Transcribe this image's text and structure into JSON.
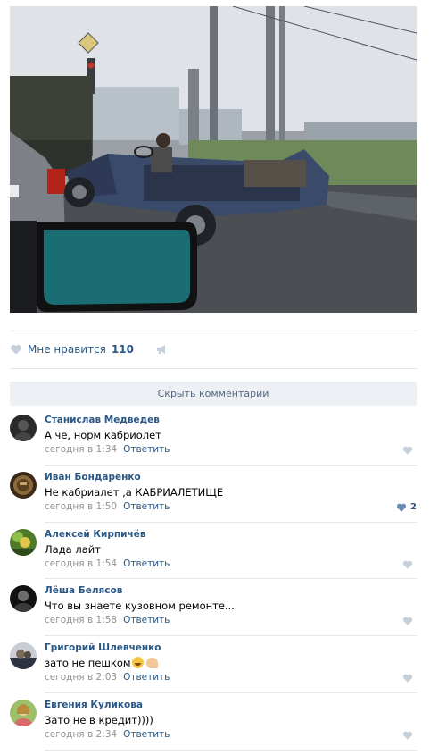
{
  "post": {
    "likes_label": "Мне нравится",
    "likes_count": "110",
    "hide_comments_label": "Скрыть комментарии"
  },
  "comments": [
    {
      "author": "Станислав Медведев",
      "text": "А че, норм кабриолет",
      "time": "сегодня в 1:34",
      "reply": "Ответить",
      "likes": ""
    },
    {
      "author": "Иван Бондаренко",
      "text": "Не кабриалет ,а КАБРИАЛЕТИЩЕ",
      "time": "сегодня в 1:50",
      "reply": "Ответить",
      "likes": "2"
    },
    {
      "author": "Алексей Кирпичёв",
      "text": "Лада лайт",
      "time": "сегодня в 1:54",
      "reply": "Ответить",
      "likes": ""
    },
    {
      "author": "Лёша Белясов",
      "text": "Что вы знаете кузовном ремонте...",
      "time": "сегодня в 1:58",
      "reply": "Ответить",
      "likes": ""
    },
    {
      "author": "Григорий Шлевченко",
      "text": "зато не пешком",
      "time": "сегодня в 2:03",
      "reply": "Ответить",
      "likes": ""
    },
    {
      "author": "Евгения Куликова",
      "text": "Зато не в кредит))))",
      "time": "сегодня в 2:34",
      "reply": "Ответить",
      "likes": ""
    }
  ],
  "colors": {
    "link": "#2a5885",
    "muted": "#939393",
    "icon": "#c5d0db",
    "icon_active": "#6b8db5"
  },
  "icons": {
    "like": "heart-icon",
    "share": "megaphone-icon",
    "emoji": "grinning-face-emoji",
    "emoji2": "flexed-biceps-emoji"
  }
}
